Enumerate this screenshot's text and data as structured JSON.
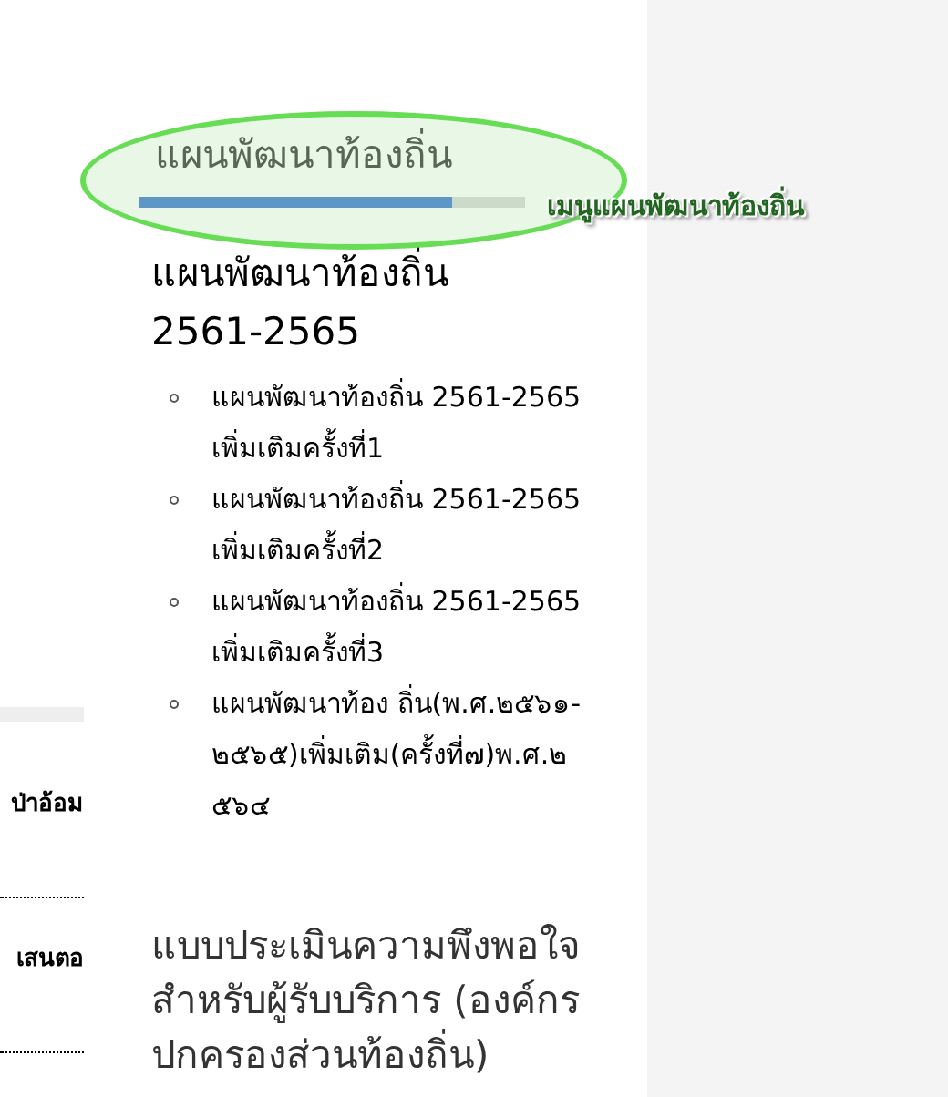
{
  "sidebar": {
    "items": [
      {
        "label": "ป่าอ้อม"
      },
      {
        "label": "เสนตอ"
      }
    ]
  },
  "section": {
    "heading": "แผนพัฒนาท้องถิ่น",
    "underline": {
      "level": 0.81
    }
  },
  "annotation": {
    "label": "เมนูแผนพัฒนาท้องถิ่น"
  },
  "plan": {
    "title": "แผนพัฒนาท้องถิ่น 2561-2565",
    "items": [
      {
        "label": "แผนพัฒนาท้องถิ่น 2561-2565 เพิ่มเติมครั้งที่1"
      },
      {
        "label": "แผนพัฒนาท้องถิ่น 2561-2565 เพิ่มเติมครั้งที่2"
      },
      {
        "label": "แผนพัฒนาท้องถิ่น 2561-2565 เพิ่มเติมครั้งที่3"
      },
      {
        "label": "แผนพัฒนาท้อง ถิ่น(พ.ศ.๒๕๖๑-๒๕๖๕)เพิ่มเติม(ครั้งที่๗)พ.ศ.๒๕๖๔"
      }
    ]
  },
  "survey": {
    "title": "แบบประเมินความพึงพอใจสำหรับผู้รับบริการ (องค์กรปกครองส่วนท้องถิ่น)"
  }
}
